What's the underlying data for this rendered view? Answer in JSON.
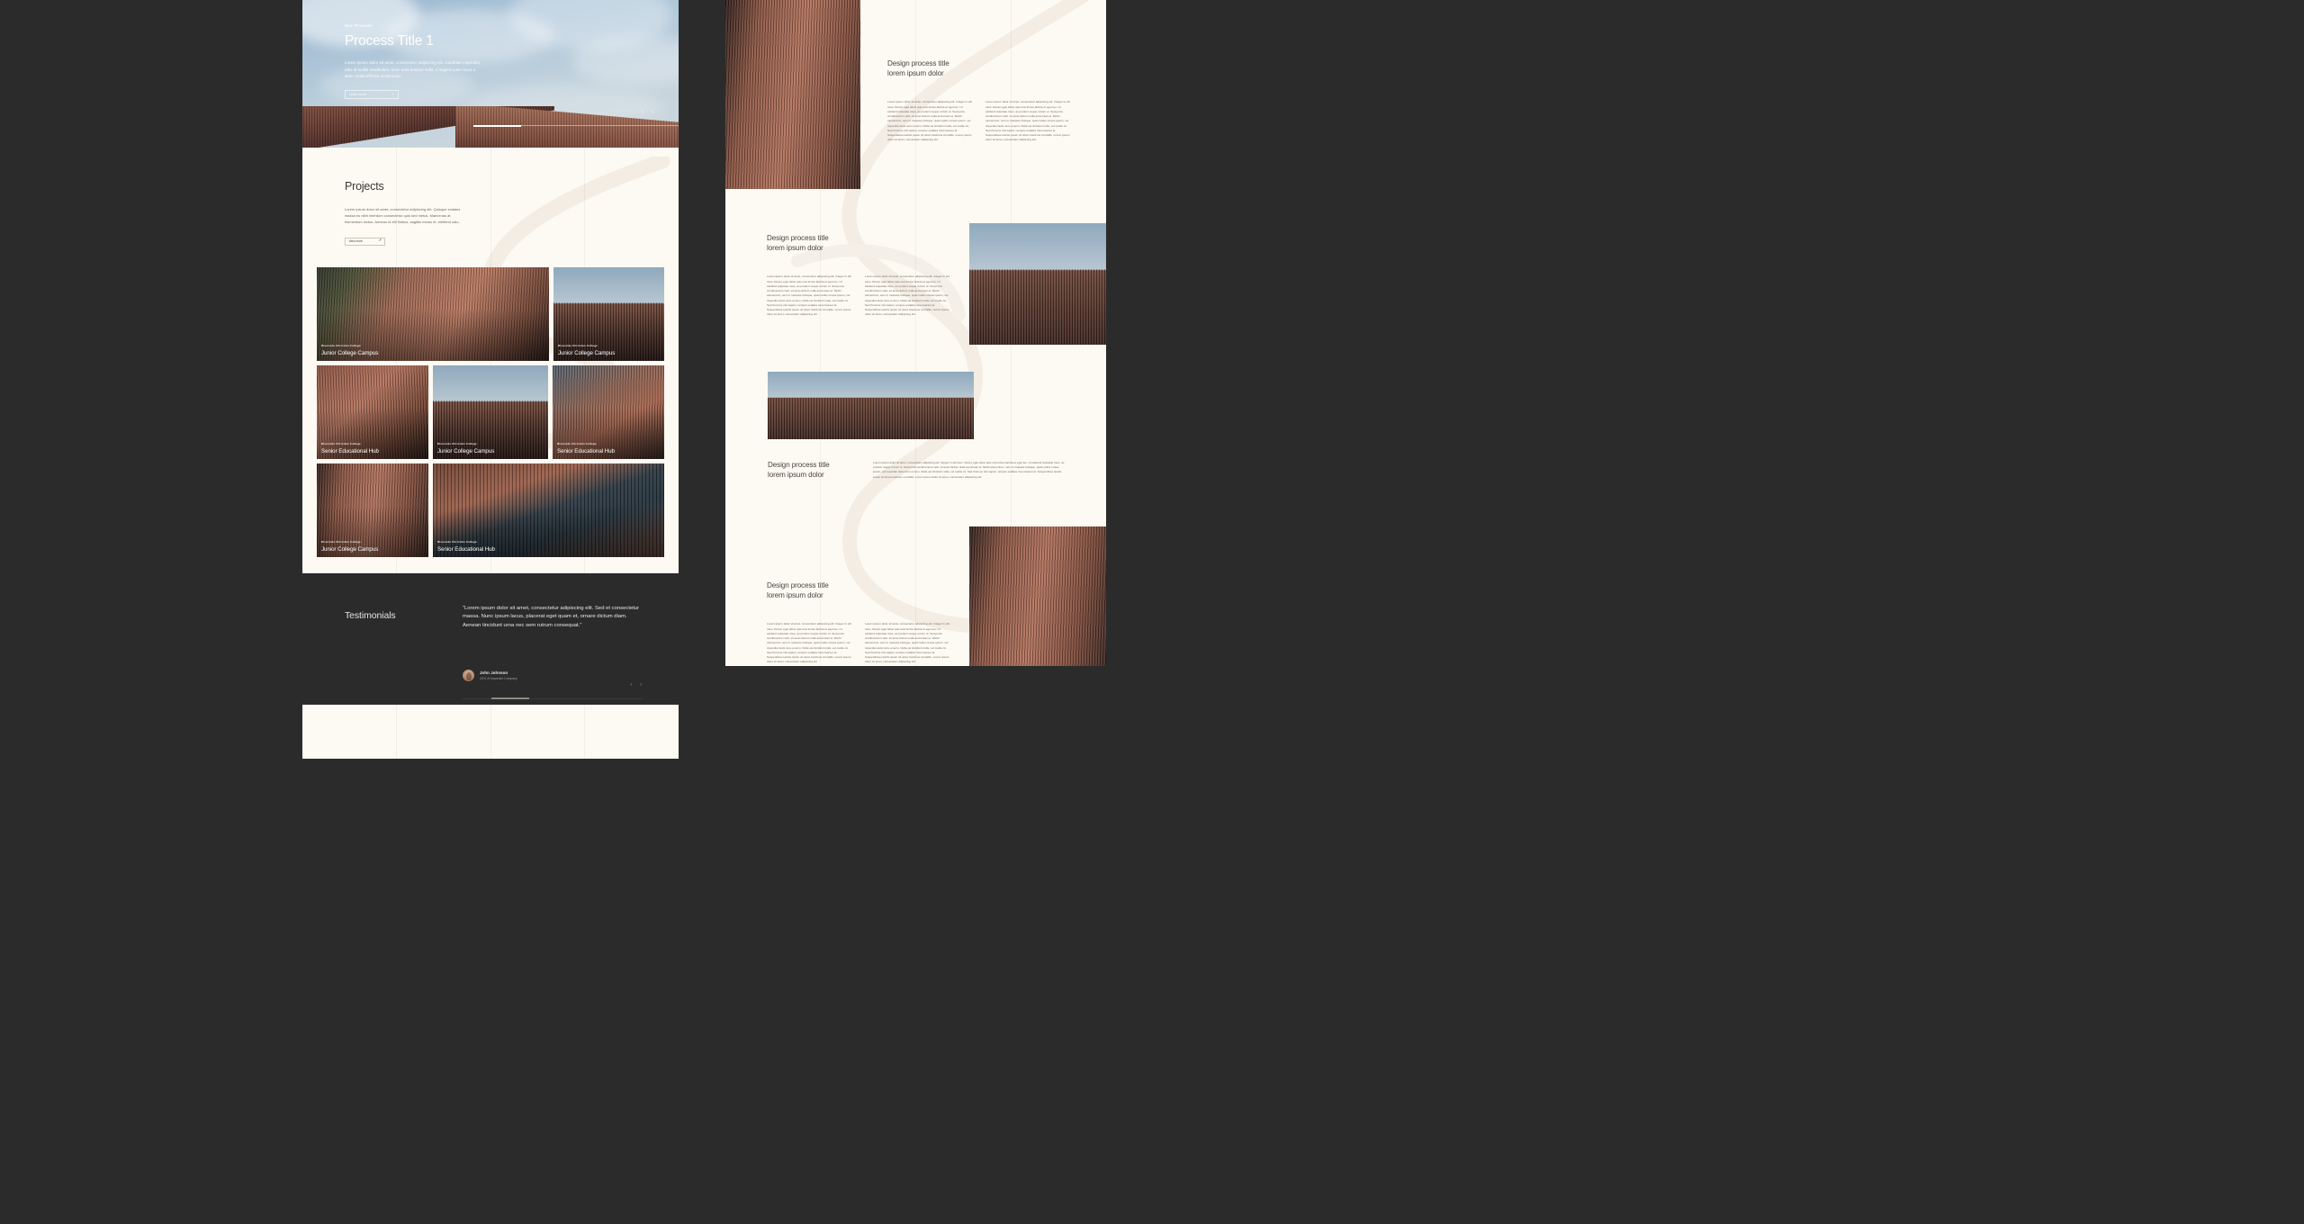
{
  "meta": {
    "canvas_bg": "#2b2b2b",
    "page_bg": "#fdfaf3",
    "accent_brick": "#a9664e"
  },
  "left_page": {
    "hero": {
      "eyebrow": "Our Process",
      "title": "Process Title 1",
      "description": "Lorem ipsum dolor sit amet, consectetur adipiscing elit. Curabitur imperdiet, odio id mollis vestibulum, nunc urna tempus nulla, a sagittis justo lacus a diam. Nulla efficitur scelerisque.",
      "cta_label": "Learn more",
      "cta_icon": "arrow-up-right-icon",
      "prev_icon": "chevron-left-icon",
      "next_icon": "chevron-right-icon",
      "progress_percent": 16
    },
    "projects": {
      "title": "Projects",
      "description": "Lorem ipsum dolor sit amet, consectetur adipiscing elit. Quisque sodales massa eu nibh interdum consectetur quis sed metus. Maecenas at elementum lectus. Aenean id elit finibus, sagittis metus et, eleifend odio.",
      "cta_label": "View more",
      "cta_icon": "arrow-up-right-icon",
      "cards": [
        {
          "kicker": "Riverside Christian College",
          "name": "Junior College Campus",
          "photo": "trees"
        },
        {
          "kicker": "Riverside Christian College",
          "name": "Junior College Campus",
          "photo": "sky-roof"
        },
        {
          "kicker": "Riverside Christian College",
          "name": "Senior Educational Hub",
          "photo": "facade"
        },
        {
          "kicker": "Riverside Christian College",
          "name": "Junior College Campus",
          "photo": "sky-roof"
        },
        {
          "kicker": "Riverside Christian College",
          "name": "Senior Educational Hub",
          "photo": "dusk"
        },
        {
          "kicker": "Riverside Christian College",
          "name": "Junior College Campus",
          "photo": "cladding"
        },
        {
          "kicker": "Riverside Christian College",
          "name": "Senior Educational Hub",
          "photo": "window"
        }
      ]
    },
    "testimonials": {
      "title": "Testimonials",
      "quote": "“Lorem ipsum dolor sit amet, consectetur adipiscing elit. Sed et consectetur massa. Nunc ipsum lacus, placerat eget quam et, ornare dictum diam. Aenean tincidunt urna nec sem rutrum consequat.”",
      "author_name": "John Johnson",
      "author_role": "CEO of Important Company",
      "prev_icon": "chevron-left-icon",
      "next_icon": "chevron-right-icon",
      "progress_percent": 21
    }
  },
  "right_page": {
    "body_paragraph": "Lorem ipsum dolor sit amet, consectetur adipiscing elit. Integer in elit risus. Donec eget tellus quis erat luctus lacinia et eget leo. Ut eleifend vulputate risus, ac pretium neque rutrum ut. Sed porta condimentum velit, sit amet dictum nulla accumsan et. Morbi elementum, sem in molestie tristique, quam tellus ornare ipsum, vel imperdiet dolor arcu et arcu. Nulla vel tincidunt nulla, vel mattis mi. Sed rhoncus nisl sapien, tempus sodales risus laoreet at. Suspendisse iaculis ipsum sit amet maximus convallis. Lorem ipsum dolor sit amet, consectetur adipiscing elit.",
    "sections": [
      {
        "title_line1": "Design process title",
        "title_line2": "lorem ipsum dolor",
        "layout": "image-left-two-col",
        "image": "cladding"
      },
      {
        "title_line1": "Design process title",
        "title_line2": "lorem ipsum dolor",
        "layout": "text-left-image-right",
        "image": "sky-roof"
      },
      {
        "title_line1": "Design process title",
        "title_line2": "lorem ipsum dolor",
        "layout": "image-above-wide-text",
        "image": "sky-roof"
      },
      {
        "title_line1": "Design process title",
        "title_line2": "lorem ipsum dolor",
        "layout": "two-col-image-right",
        "image": "cladding"
      }
    ]
  }
}
